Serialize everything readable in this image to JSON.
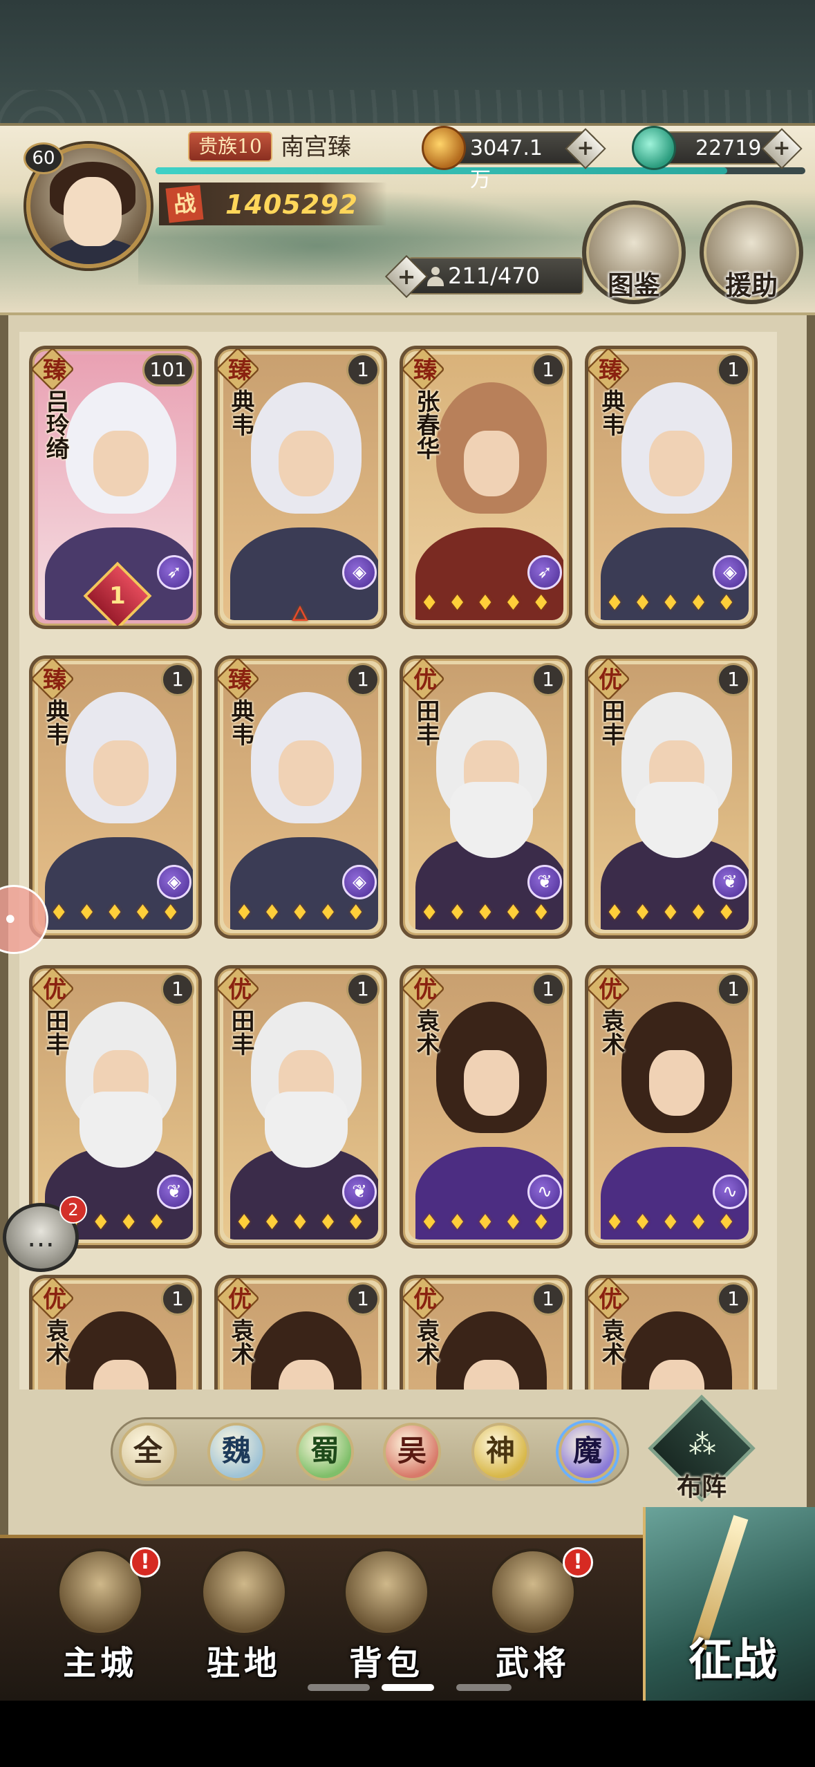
{
  "player": {
    "level": "60",
    "noble_rank": "贵族10",
    "name": "南宫臻",
    "power_label": "战",
    "power": "1405292",
    "exp_progress": 0.88
  },
  "resources": {
    "gold": "3047.1万",
    "jade": "22719",
    "plus": "+"
  },
  "roster": {
    "count": "211/470",
    "plus": "+"
  },
  "side_buttons": {
    "codex": "图鉴",
    "support": "援助"
  },
  "cards": [
    {
      "rarity": "臻",
      "name": "吕玲绮",
      "count": "101",
      "class_icon": "bow-icon",
      "stars": "",
      "medal": "1",
      "theme": "pink"
    },
    {
      "rarity": "臻",
      "name": "典韦",
      "count": "1",
      "class_icon": "shield-icon",
      "stars": "ﾛ",
      "theme": "wei"
    },
    {
      "rarity": "臻",
      "name": "张春华",
      "count": "1",
      "class_icon": "bow-icon",
      "stars": "ﾛﾛﾛﾛﾛ",
      "theme": "girl"
    },
    {
      "rarity": "臻",
      "name": "典韦",
      "count": "1",
      "class_icon": "shield-icon",
      "stars": "ﾛﾛﾛﾛﾛ",
      "theme": "wei"
    },
    {
      "rarity": "臻",
      "name": "典韦",
      "count": "1",
      "class_icon": "shield-icon",
      "stars": "ﾛﾛﾛﾛﾛ",
      "theme": "wei"
    },
    {
      "rarity": "臻",
      "name": "典韦",
      "count": "1",
      "class_icon": "shield-icon",
      "stars": "ﾛﾛﾛﾛﾛ",
      "theme": "wei"
    },
    {
      "rarity": "优",
      "name": "田丰",
      "count": "1",
      "class_icon": "leaf-icon",
      "stars": "ﾛﾛﾛﾛﾛ",
      "theme": "elder"
    },
    {
      "rarity": "优",
      "name": "田丰",
      "count": "1",
      "class_icon": "leaf-icon",
      "stars": "ﾛﾛﾛﾛﾛ",
      "theme": "elder"
    },
    {
      "rarity": "优",
      "name": "田丰",
      "count": "1",
      "class_icon": "leaf-icon",
      "stars": "ﾛﾛﾛﾛ",
      "theme": "elder"
    },
    {
      "rarity": "优",
      "name": "田丰",
      "count": "1",
      "class_icon": "leaf-icon",
      "stars": "ﾛﾛﾛﾛﾛ",
      "theme": "elder"
    },
    {
      "rarity": "优",
      "name": "袁术",
      "count": "1",
      "class_icon": "swirl-icon",
      "stars": "ﾛﾛﾛﾛﾛ",
      "theme": "lord"
    },
    {
      "rarity": "优",
      "name": "袁术",
      "count": "1",
      "class_icon": "swirl-icon",
      "stars": "ﾛﾛﾛﾛﾛ",
      "theme": "lord"
    },
    {
      "rarity": "优",
      "name": "袁术",
      "count": "1",
      "class_icon": "swirl-icon",
      "stars": "",
      "theme": "lord"
    },
    {
      "rarity": "优",
      "name": "袁术",
      "count": "1",
      "class_icon": "swirl-icon",
      "stars": "",
      "theme": "lord"
    },
    {
      "rarity": "优",
      "name": "袁术",
      "count": "1",
      "class_icon": "swirl-icon",
      "stars": "",
      "theme": "lord"
    },
    {
      "rarity": "优",
      "name": "袁术",
      "count": "1",
      "class_icon": "swirl-icon",
      "stars": "",
      "theme": "lord"
    }
  ],
  "factions": [
    {
      "label": "全",
      "color": "#d8c9a2",
      "text": "#3b2a18"
    },
    {
      "label": "魏",
      "color": "#9fc3d6",
      "text": "#1d3a5a"
    },
    {
      "label": "蜀",
      "color": "#7fbf6a",
      "text": "#1e4a1a"
    },
    {
      "label": "吴",
      "color": "#d87a6a",
      "text": "#5a1a12"
    },
    {
      "label": "神",
      "color": "#d8b84a",
      "text": "#4a3510"
    },
    {
      "label": "魔",
      "color": "#8a7ad8",
      "text": "#1a1240"
    }
  ],
  "formation": {
    "label": "布阵"
  },
  "chat": {
    "unread": "2"
  },
  "nav": [
    {
      "label": "主城",
      "alert": "!"
    },
    {
      "label": "驻地",
      "alert": ""
    },
    {
      "label": "背包",
      "alert": ""
    },
    {
      "label": "武将",
      "alert": "!"
    }
  ],
  "battle": {
    "label": "征战"
  },
  "colors": {
    "gold_text": "#ffd65a",
    "accent_teal": "#3fd1c6",
    "alert_red": "#d62a22"
  }
}
